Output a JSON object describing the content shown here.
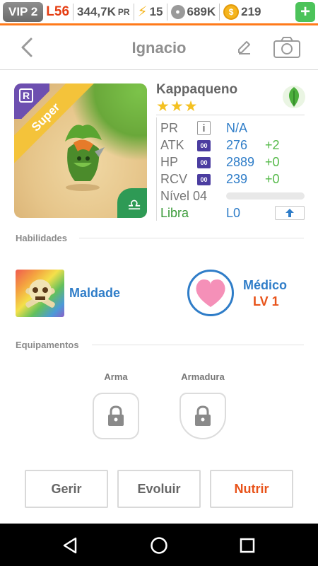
{
  "status_bar": {
    "vip": "VIP 2",
    "level": "L56",
    "power": "344,7K",
    "power_unit": "PR",
    "energy": "15",
    "food": "689K",
    "coins": "219",
    "add_label": "+"
  },
  "header": {
    "title": "Ignacio"
  },
  "monster": {
    "name": "Kappaqueno",
    "stars": "★★★",
    "rarity": "Super",
    "rank_letter": "R",
    "element": "nature",
    "zodiac_symbol": "♎"
  },
  "stats": {
    "pr_label": "PR",
    "pr_value": "N/A",
    "atk_label": "ATK",
    "atk_value": "276",
    "atk_bonus": "+2",
    "hp_label": "HP",
    "hp_value": "2889",
    "hp_bonus": "+0",
    "rcv_label": "RCV",
    "rcv_value": "239",
    "rcv_bonus": "+0",
    "chip": "00",
    "level_label": "Nível 04",
    "level_progress": 0,
    "sign_label": "Libra",
    "sign_level": "L0"
  },
  "sections": {
    "skills": "Habilidades",
    "equipment": "Equipamentos"
  },
  "skills": [
    {
      "name": "Maldade"
    },
    {
      "name": "Médico",
      "level": "LV 1"
    }
  ],
  "equipment": {
    "weapon": "Arma",
    "armor": "Armadura"
  },
  "actions": {
    "manage": "Gerir",
    "evolve": "Evoluir",
    "feed": "Nutrir"
  },
  "colors": {
    "accent_blue": "#2f7dc8",
    "accent_orange": "#e8531a",
    "bonus_green": "#54b948"
  }
}
